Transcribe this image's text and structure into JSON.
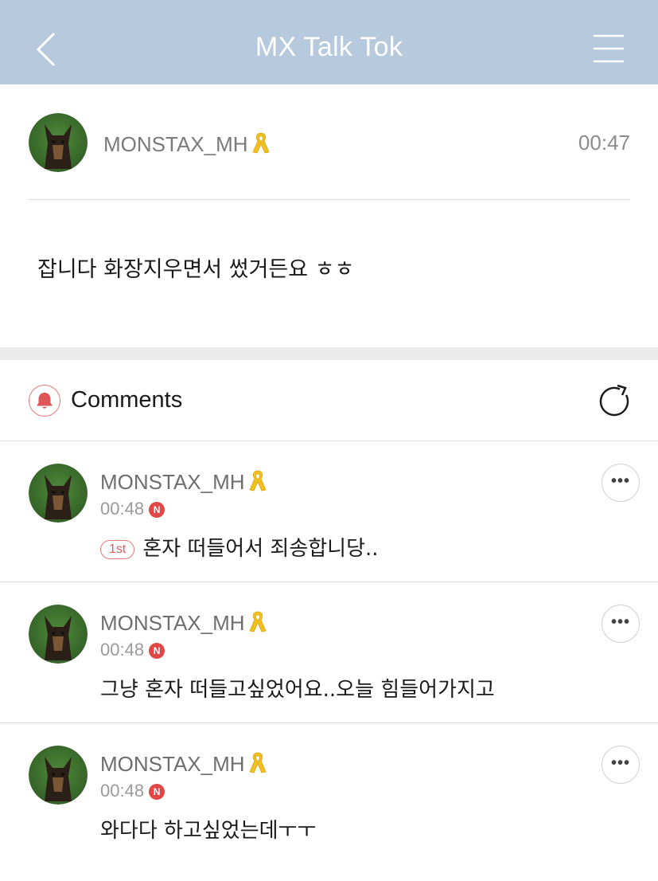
{
  "header": {
    "title": "MX Talk Tok",
    "back_icon": "chevron-left-icon",
    "menu_icon": "hamburger-menu-icon"
  },
  "post": {
    "author": "MONSTAX_MH",
    "time": "00:47",
    "body": "잡니다 화장지우면서 썼거든요 ㅎㅎ"
  },
  "comments_section": {
    "title": "Comments",
    "bell_icon": "bell-icon",
    "refresh_icon": "refresh-icon"
  },
  "comments": [
    {
      "author": "MONSTAX_MH",
      "time": "00:48",
      "badge": "N",
      "rank": "1st",
      "text": "혼자 떠들어서 죄송합니당.."
    },
    {
      "author": "MONSTAX_MH",
      "time": "00:48",
      "badge": "N",
      "text": "그냥 혼자 떠들고싶었어요..오늘 힘들어가지고"
    },
    {
      "author": "MONSTAX_MH",
      "time": "00:48",
      "badge": "N",
      "text": "와다다 하고싶었는데ㅜㅜ"
    }
  ],
  "colors": {
    "header_bg": "#b7c9dc",
    "badge_red": "#e04848",
    "ribbon_yellow": "#f2c01e"
  }
}
